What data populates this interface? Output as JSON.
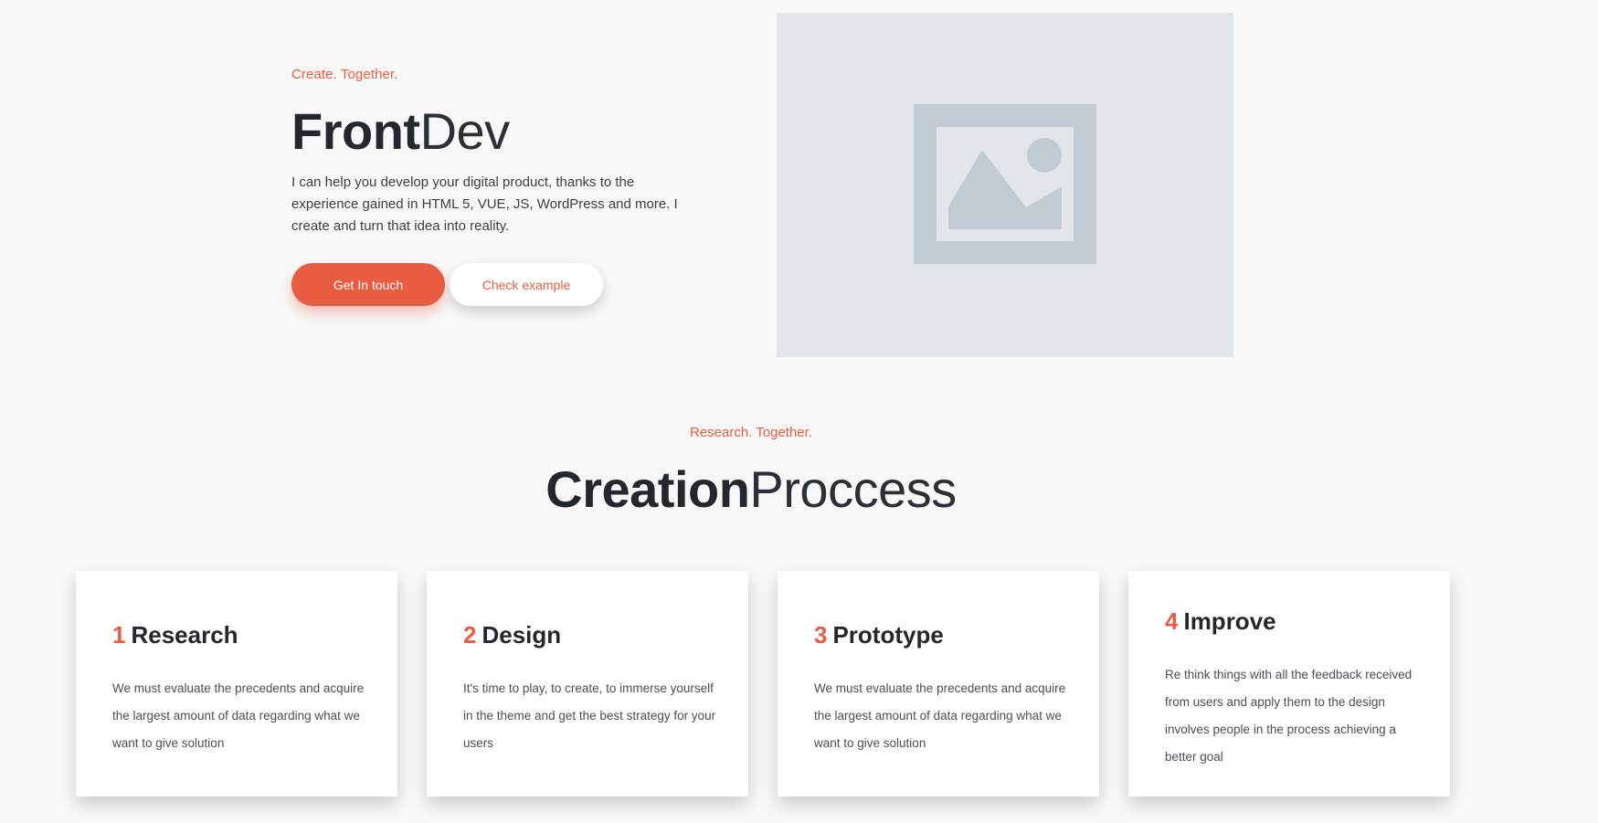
{
  "hero": {
    "eyebrow": "Create. Together.",
    "title_bold": "Front",
    "title_light": "Dev",
    "description": "I can help you develop your digital product, thanks to the experience gained in HTML 5, VUE, JS, WordPress and more. I create and turn that idea into reality.",
    "buttons": {
      "primary": "Get In touch",
      "secondary": "Check example"
    },
    "image_icon": "image-placeholder-icon"
  },
  "process": {
    "eyebrow": "Research. Together.",
    "title_bold": "Creation",
    "title_light": "Proccess",
    "steps": [
      {
        "number": "1",
        "title": "Research",
        "text": "We must evaluate the precedents and acquire the largest amount of data regarding what we want to give solution"
      },
      {
        "number": "2",
        "title": "Design",
        "text": "It's time to play, to create, to immerse yourself in the theme and get the best strategy for your users"
      },
      {
        "number": "3",
        "title": "Prototype",
        "text": "We must evaluate the precedents and acquire the largest amount of data regarding what we want to give solution"
      },
      {
        "number": "4",
        "title": "Improve",
        "text": "Re think things with all the feedback received from users and apply them to the design involves people in the process achieving a better goal"
      }
    ]
  },
  "colors": {
    "accent": "#e85c41",
    "background": "#f8f8f8",
    "text": "#23272e",
    "placeholder_bg": "#e2e6ea",
    "placeholder_fg": "#c2cbd3"
  }
}
